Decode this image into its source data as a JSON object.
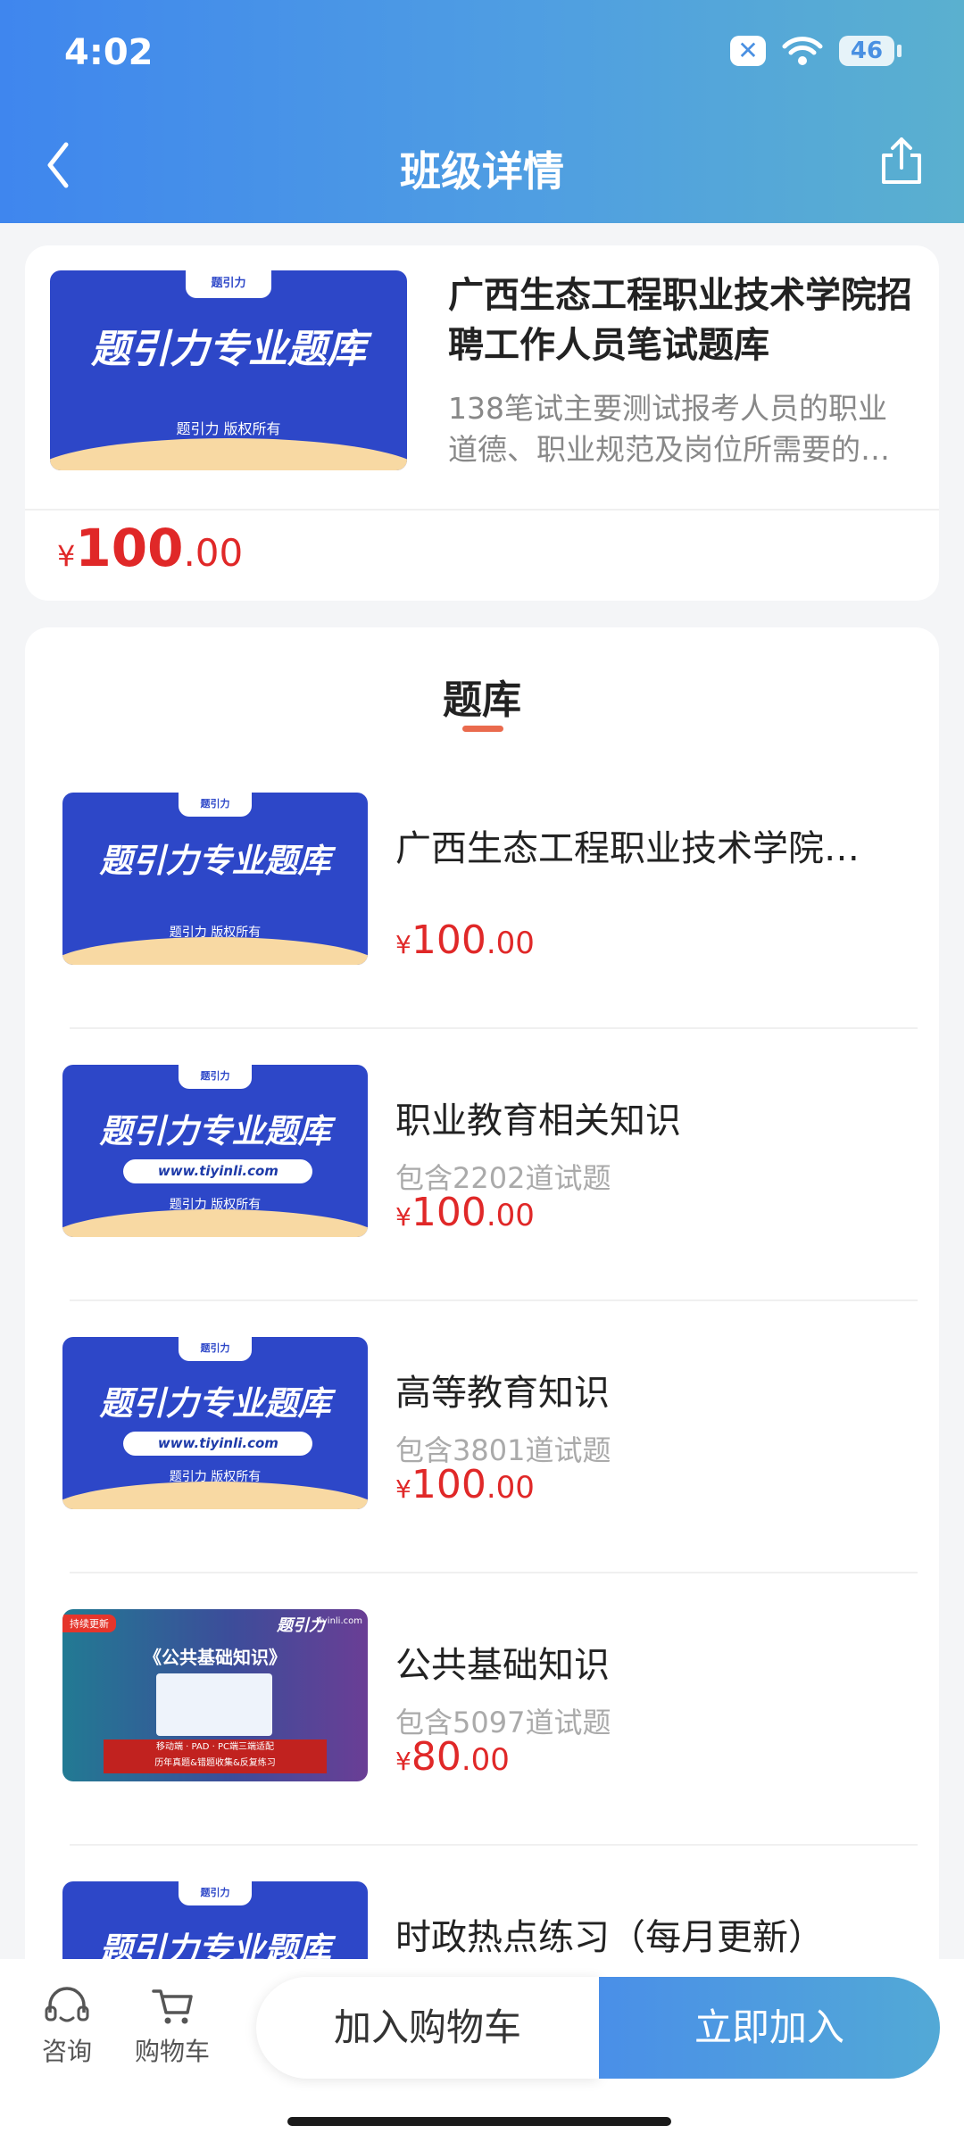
{
  "status_bar": {
    "time": "4:02",
    "battery": "46"
  },
  "nav": {
    "title": "班级详情"
  },
  "class_card": {
    "title": "广西生态工程职业技术学院招聘工作人员笔试题库",
    "description": "138笔试主要测试报考人员的职业道德、职业规范及岗位所需要的…",
    "price": {
      "currency": "¥",
      "integer": "100",
      "decimal": ".00"
    },
    "thumbnail": {
      "logo": "题引力",
      "title": "题引力专业题库",
      "subtitle": "题引力 版权所有"
    }
  },
  "question_bank": {
    "tab_label": "题库",
    "items": [
      {
        "name": "广西生态工程职业技术学院…",
        "count": "",
        "price_int": "100",
        "price_dec": ".00",
        "currency": "¥",
        "thumb": {
          "logo": "题引力",
          "title": "题引力专业题库",
          "url": "",
          "subtitle": "题引力 版权所有"
        }
      },
      {
        "name": "职业教育相关知识",
        "count": "包含2202道试题",
        "price_int": "100",
        "price_dec": ".00",
        "currency": "¥",
        "thumb": {
          "logo": "题引力",
          "title": "题引力专业题库",
          "url": "www.tiyinli.com",
          "subtitle": "题引力 版权所有"
        }
      },
      {
        "name": "高等教育知识",
        "count": "包含3801道试题",
        "price_int": "100",
        "price_dec": ".00",
        "currency": "¥",
        "thumb": {
          "logo": "题引力",
          "title": "题引力专业题库",
          "url": "www.tiyinli.com",
          "subtitle": "题引力 版权所有"
        }
      },
      {
        "name": "公共基础知识",
        "count": "包含5097道试题",
        "price_int": "80",
        "price_dec": ".00",
        "currency": "¥",
        "thumb": {
          "badge": "持续更新",
          "brand": "题引力",
          "site": "tiyinli.com",
          "title": "《公共基础知识》",
          "banner_line1": "移动端 · PAD · PC端三端适配",
          "banner_line2": "历年真题&错题收集&反复练习"
        }
      },
      {
        "name": "时政热点练习（每月更新）",
        "count": "",
        "price_int": "",
        "price_dec": "",
        "currency": "",
        "thumb": {
          "logo": "题引力",
          "title": "题引力专业题库"
        }
      }
    ]
  },
  "bottom_bar": {
    "consult_label": "咨询",
    "cart_label": "购物车",
    "add_to_cart": "加入购物车",
    "join_now": "立即加入"
  }
}
